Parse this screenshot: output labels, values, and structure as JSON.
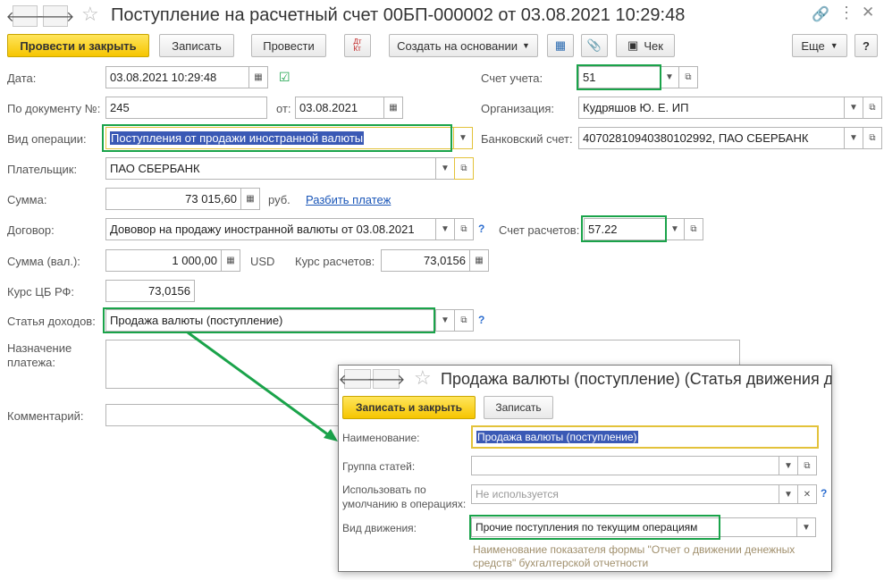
{
  "window": {
    "title": "Поступление на расчетный счет 00БП-000002 от 03.08.2021 10:29:48"
  },
  "toolbar": {
    "post_close": "Провести и закрыть",
    "save": "Записать",
    "post": "Провести",
    "dt_kt": "Дт Кт",
    "create_based": "Создать на основании",
    "receipt": "Чек",
    "more": "Еще",
    "help": "?"
  },
  "form": {
    "date_label": "Дата:",
    "date_value": "03.08.2021 10:29:48",
    "doc_no_label": "По документу №:",
    "doc_no_value": "245",
    "from_label": "от:",
    "from_value": "03.08.2021",
    "op_type_label": "Вид операции:",
    "op_type_value": "Поступления от продажи иностранной валюты",
    "payer_label": "Плательщик:",
    "payer_value": "ПАО СБЕРБАНК",
    "amount_label": "Сумма:",
    "amount_value": "73 015,60",
    "amount_currency": "руб.",
    "split_link": "Разбить платеж",
    "contract_label": "Договор:",
    "contract_value": "Дововор на продажу иностранной валюты от 03.08.2021",
    "amount_val_label": "Сумма (вал.):",
    "amount_val_value": "1 000,00",
    "amount_val_currency": "USD",
    "rate_label": "Курс расчетов:",
    "rate_value": "73,0156",
    "cb_rate_label": "Курс ЦБ РФ:",
    "cb_rate_value": "73,0156",
    "income_item_label": "Статья доходов:",
    "income_item_value": "Продажа валюты (поступление)",
    "purpose_label_1": "Назначение",
    "purpose_label_2": "платежа:",
    "comment_label": "Комментарий:",
    "account_label": "Счет учета:",
    "account_value": "51",
    "org_label": "Организация:",
    "org_value": "Кудряшов Ю. Е. ИП",
    "bank_label": "Банковский счет:",
    "bank_value": "40702810940380102992, ПАО СБЕРБАНК",
    "settle_label": "Счет расчетов:",
    "settle_value": "57.22",
    "help_mark": "?"
  },
  "popup": {
    "title": "Продажа валюты (поступление) (Статья движения де",
    "save_close": "Записать и закрыть",
    "save": "Записать",
    "name_label": "Наименование:",
    "name_value": "Продажа валюты (поступление)",
    "group_label": "Группа статей:",
    "group_value": "",
    "default_label_1": "Использовать по",
    "default_label_2": "умолчанию в операциях:",
    "default_placeholder": "Не используется",
    "movement_label": "Вид движения:",
    "movement_value": "Прочие поступления по текущим операциям",
    "hint_1": "Наименование показателя формы \"Отчет о движении денежных",
    "hint_2": "средств\" бухгалтерской отчетности",
    "help_mark": "?"
  },
  "colors": {
    "highlight_green": "#1aa34a",
    "primary_button": "#f6c500",
    "selection": "#3a59b5",
    "link": "#1a56b8"
  }
}
